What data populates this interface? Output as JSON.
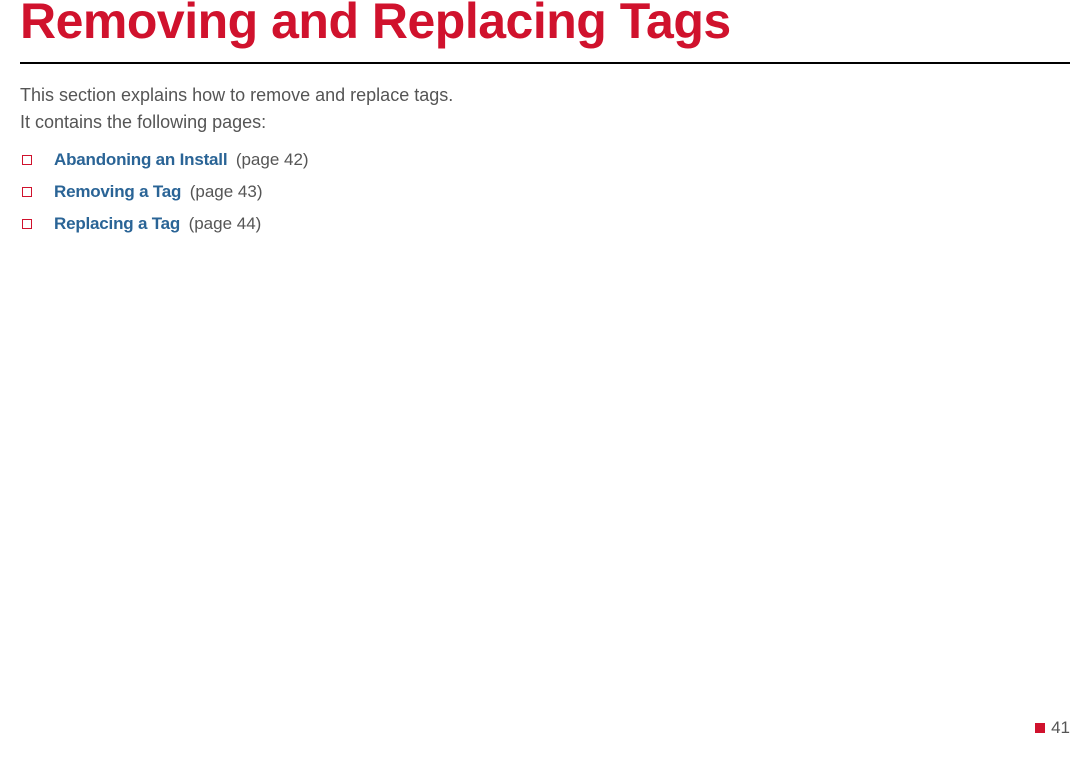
{
  "title": "Removing and Replacing Tags",
  "intro_line1": "This section explains how to remove and replace tags.",
  "intro_line2": "It contains the following pages:",
  "toc": [
    {
      "link": "Abandoning an Install",
      "ref": "(page 42)"
    },
    {
      "link": "Removing a Tag",
      "ref": "(page 43)"
    },
    {
      "link": "Replacing a Tag",
      "ref": "(page 44)"
    }
  ],
  "page_number": "41"
}
